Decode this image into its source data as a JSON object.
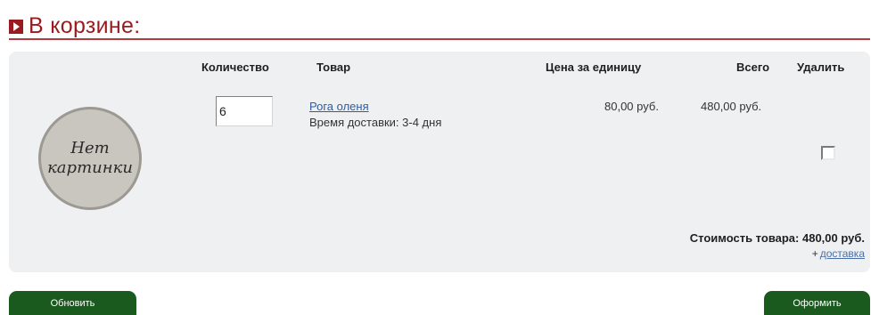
{
  "header": {
    "title": "В корзине:"
  },
  "columns": {
    "quantity": "Количество",
    "product": "Товар",
    "unit_price": "Цена за единицу",
    "total": "Всего",
    "delete": "Удалить"
  },
  "item": {
    "image_placeholder_line1": "Нет",
    "image_placeholder_line2": "картинки",
    "quantity_value": "6",
    "product_name": "Рога оленя",
    "delivery_time": "Время доставки: 3-4 дня",
    "unit_price": "80,00 руб.",
    "total": "480,00 руб.",
    "delete_checked": false
  },
  "summary": {
    "goods_total": "Стоимость товара: 480,00 руб.",
    "delivery_plus": "+",
    "delivery_link": "доставка"
  },
  "buttons": {
    "update": "Обновить",
    "checkout": "Оформить"
  },
  "colors": {
    "accent_red": "#9a1b1f",
    "button_green": "#1b5a1f",
    "panel_bg": "#eff0f1",
    "link_blue": "#2f5c9f"
  },
  "icons": {
    "header_marker": "play-icon"
  }
}
